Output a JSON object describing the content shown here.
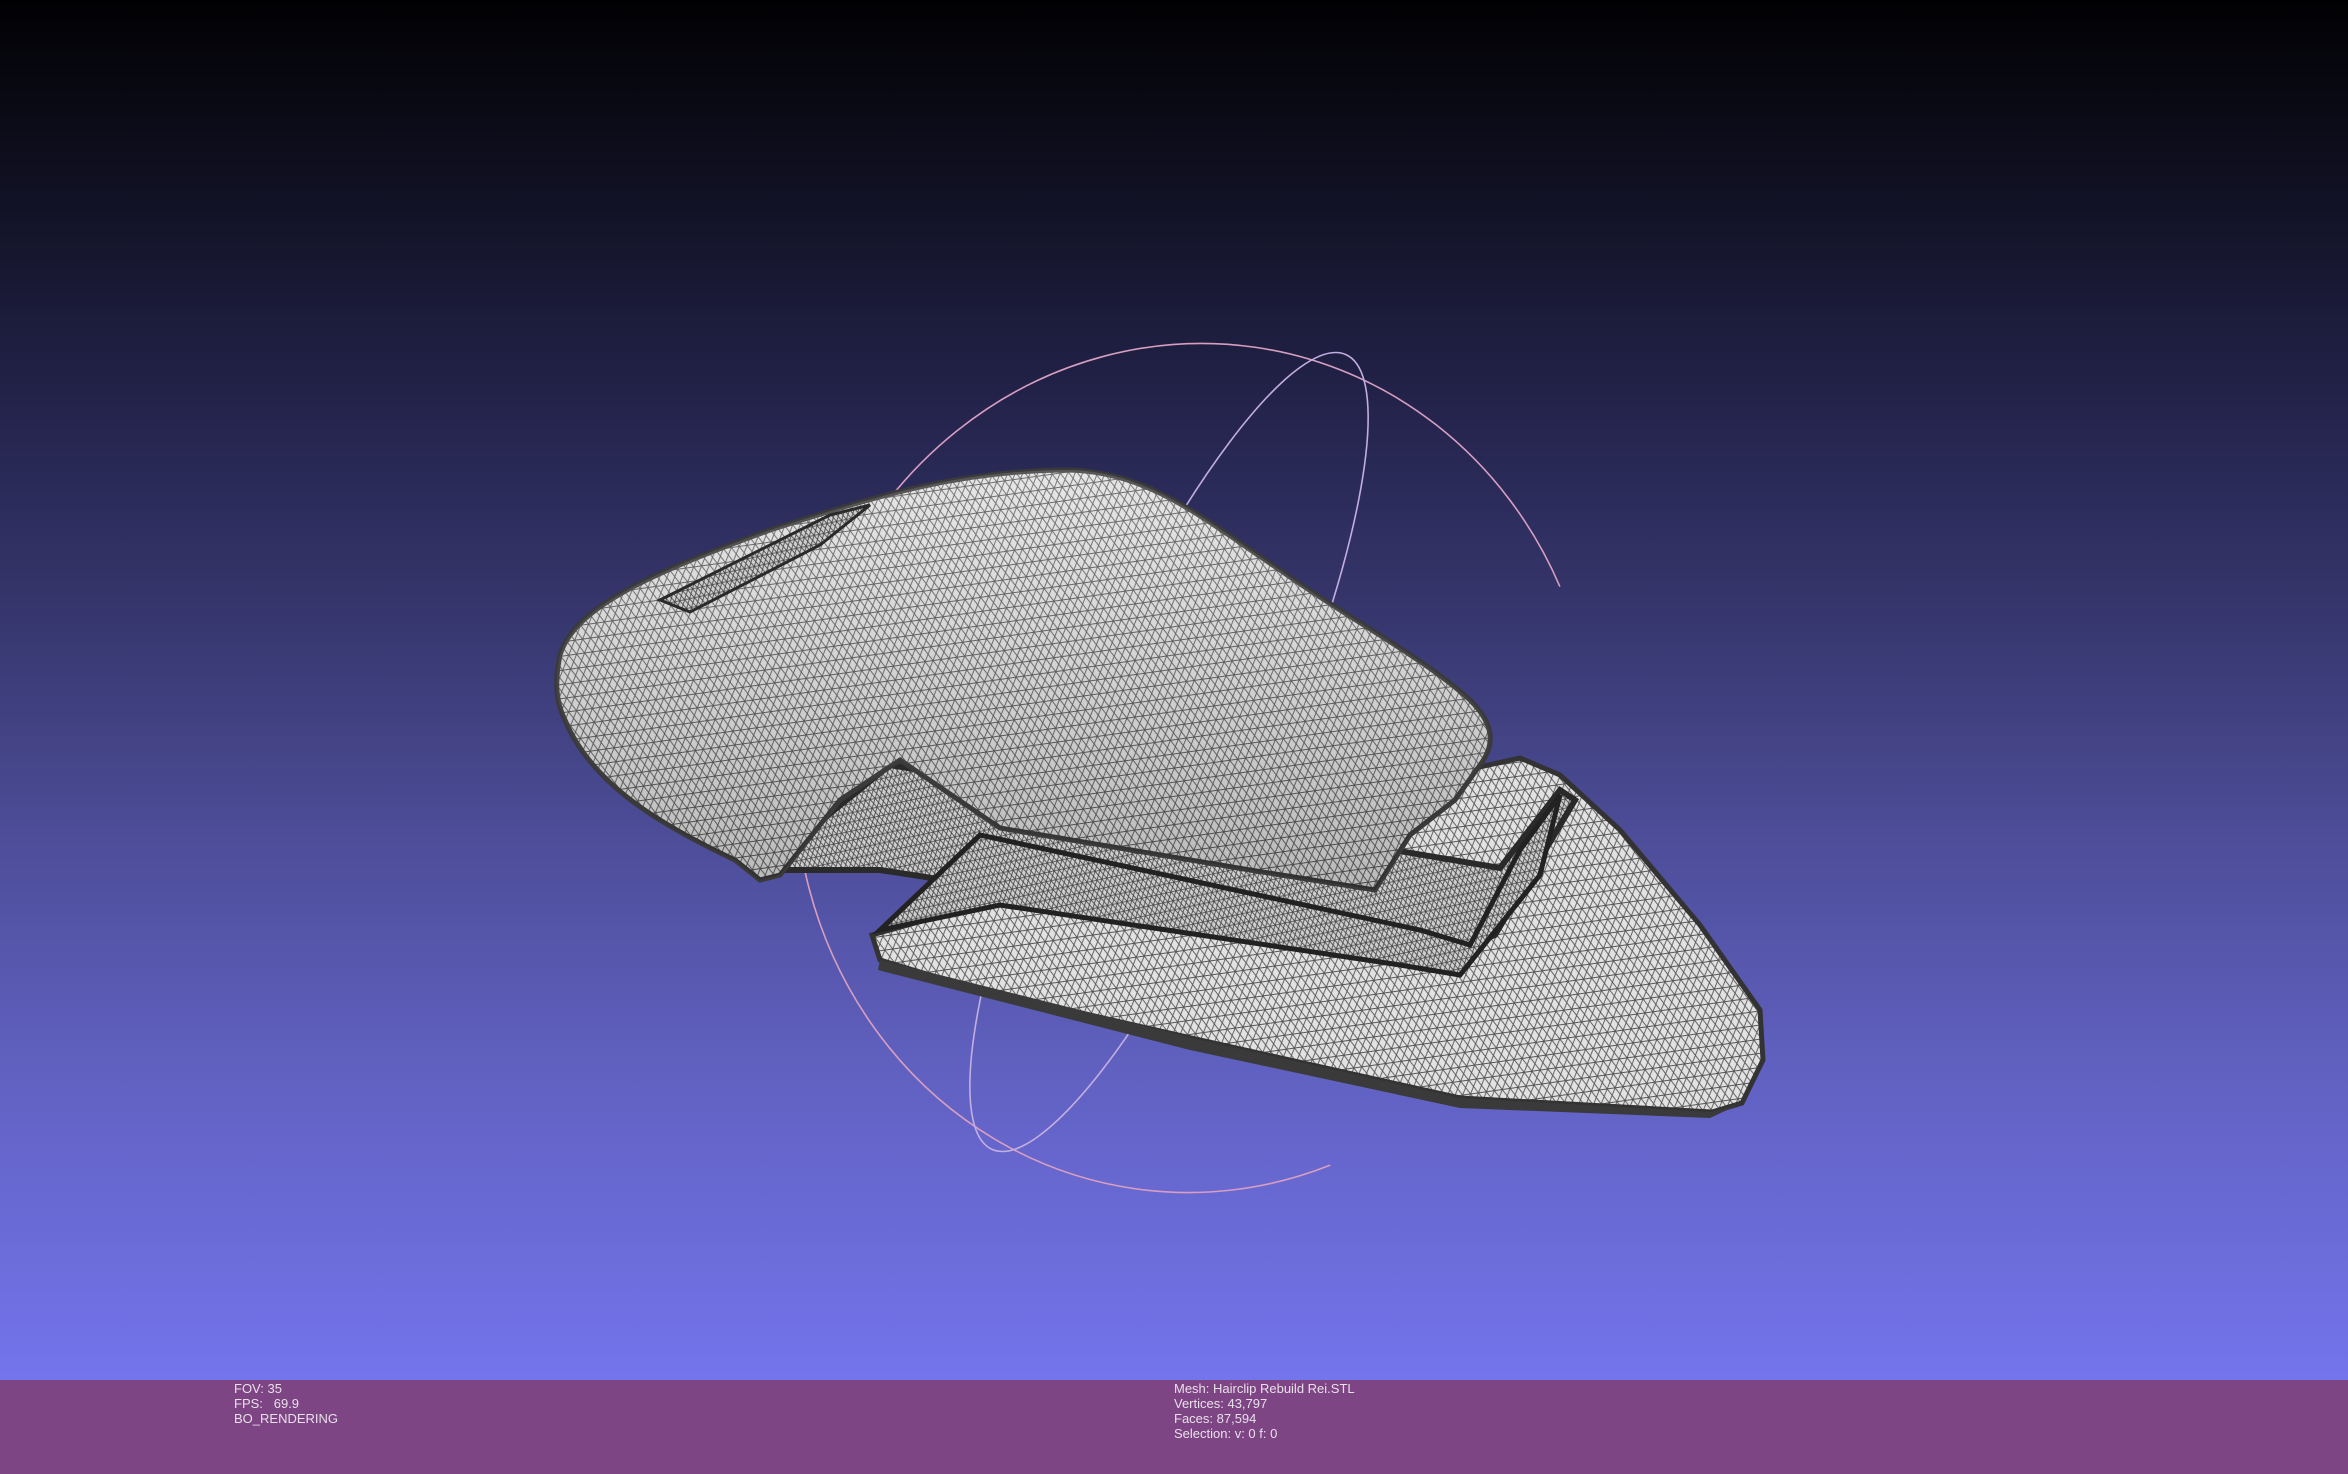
{
  "app": {
    "background_top_color": "#010103",
    "background_bottom_color": "#7474ec",
    "status_bar_color": "#7e4584"
  },
  "status_left": {
    "fov": "FOV: 35",
    "fps": "FPS:   69.9",
    "render_mode": "BO_RENDERING"
  },
  "status_right": {
    "mesh": "Mesh: Hairclip Rebuild Rei.STL",
    "vertices": "Vertices: 43,797",
    "faces": "Faces: 87,594",
    "selection": "Selection: v: 0 f: 0"
  },
  "viewport": {
    "model_icon": "wireframe-mesh-model",
    "trackball_icon": "trackball-gizmo",
    "mesh_fill_color": "#dcdcdc",
    "mesh_wire_color": "#4a4a4a"
  }
}
